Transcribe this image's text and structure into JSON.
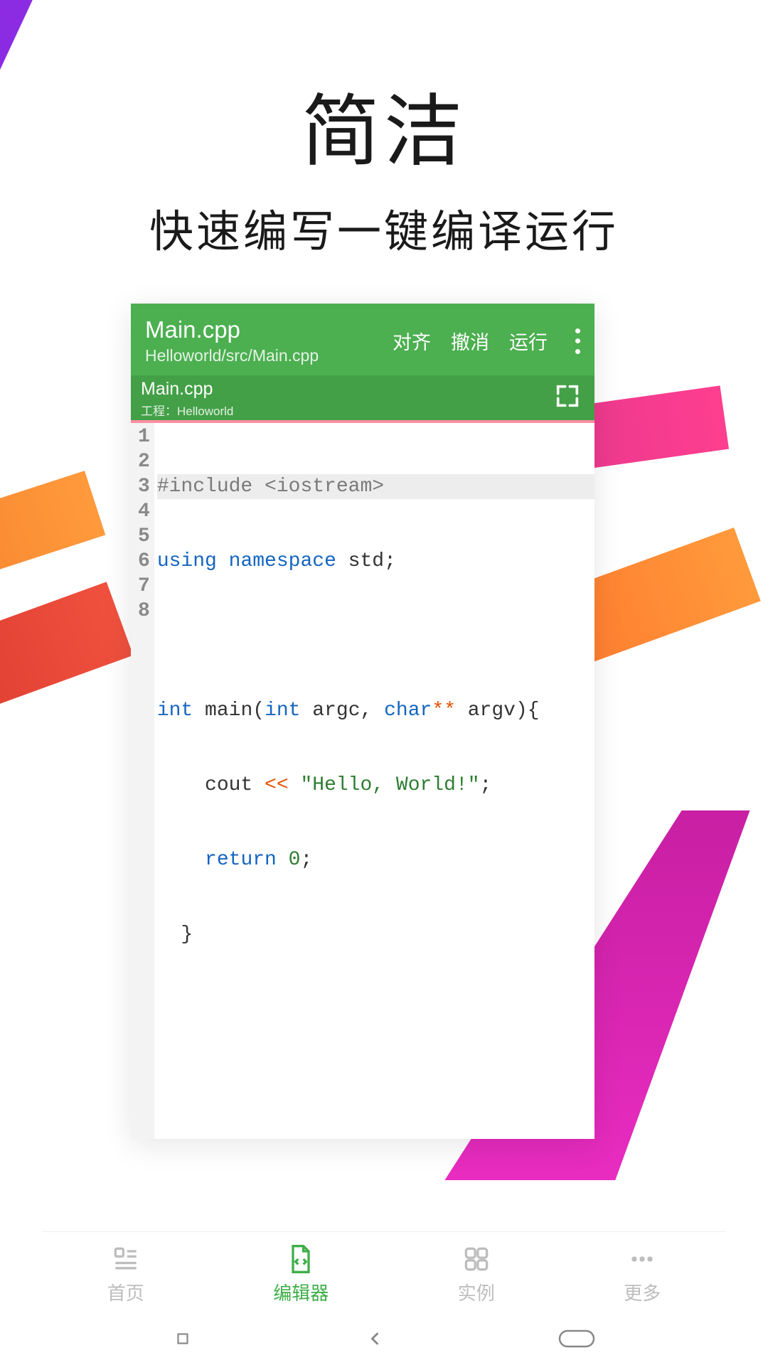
{
  "hero": {
    "title": "简洁",
    "subtitle": "快速编写一键编译运行"
  },
  "editor": {
    "filename": "Main.cpp",
    "filepath": "Helloworld/src/Main.cpp",
    "actions": {
      "align": "对齐",
      "undo": "撤消",
      "run": "运行"
    },
    "tab": {
      "name": "Main.cpp",
      "project": "工程：Helloworld"
    },
    "code": {
      "line1": "#include <iostream>",
      "line2_kw1": "using",
      "line2_kw2": "namespace",
      "line2_rest": " std;",
      "line4_kw1": "int",
      "line4_txt1": " main(",
      "line4_kw2": "int",
      "line4_txt2": " argc, ",
      "line4_kw3": "char",
      "line4_op": "**",
      "line4_txt3": " argv){",
      "line5_pre": "    cout ",
      "line5_op": "<<",
      "line5_sp": " ",
      "line5_str": "\"Hello, World!\"",
      "line5_end": ";",
      "line6_pre": "    ",
      "line6_kw": "return",
      "line6_sp": " ",
      "line6_num": "0",
      "line6_end": ";",
      "line7": "  }"
    },
    "line_numbers": [
      "1",
      "2",
      "3",
      "4",
      "5",
      "6",
      "7",
      "8"
    ]
  },
  "nav": {
    "home": "首页",
    "editor": "编辑器",
    "examples": "实例",
    "more": "更多"
  }
}
